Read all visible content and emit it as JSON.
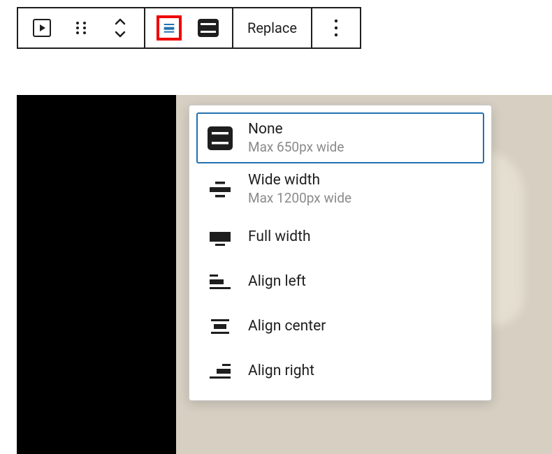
{
  "toolbar": {
    "replace_label": "Replace"
  },
  "alignment_menu": {
    "items": [
      {
        "title": "None",
        "sub": "Max 650px wide"
      },
      {
        "title": "Wide width",
        "sub": "Max 1200px wide"
      },
      {
        "title": "Full width",
        "sub": ""
      },
      {
        "title": "Align left",
        "sub": ""
      },
      {
        "title": "Align center",
        "sub": ""
      },
      {
        "title": "Align right",
        "sub": ""
      }
    ]
  }
}
